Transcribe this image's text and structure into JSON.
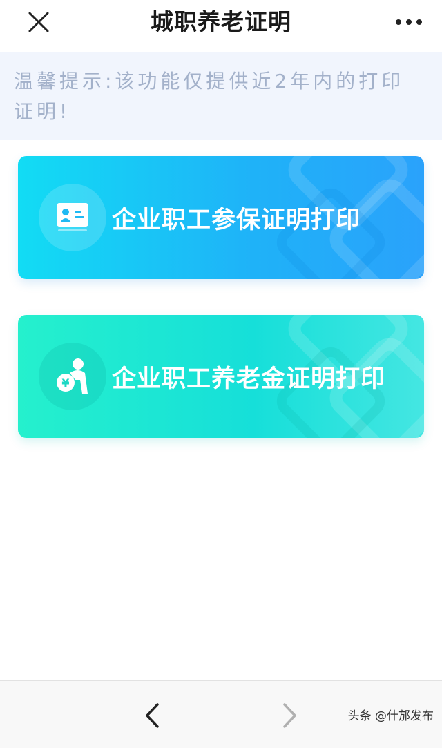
{
  "header": {
    "title": "城职养老证明",
    "close_icon": "close-icon",
    "more_icon": "more-icon"
  },
  "notice": {
    "text": "温馨提示:该功能仅提供近2年内的打印证明!"
  },
  "cards": [
    {
      "label": "企业职工参保证明打印",
      "icon": "id-card-icon",
      "gradient": [
        "#12dcf4",
        "#2aa2fb"
      ]
    },
    {
      "label": "企业职工养老金证明打印",
      "icon": "elderly-pension-icon",
      "gradient": [
        "#25f0cd",
        "#44e6e2"
      ]
    }
  ],
  "bottom_nav": {
    "back_icon": "chevron-left-icon",
    "forward_icon": "chevron-right-icon"
  },
  "watermark": "头条 @什邡发布",
  "colors": {
    "title": "#1a1a1a",
    "notice_text": "#a3b1ca",
    "notice_bg": "#f1f5fd",
    "bottom_bar_bg": "#f8f8f8"
  }
}
